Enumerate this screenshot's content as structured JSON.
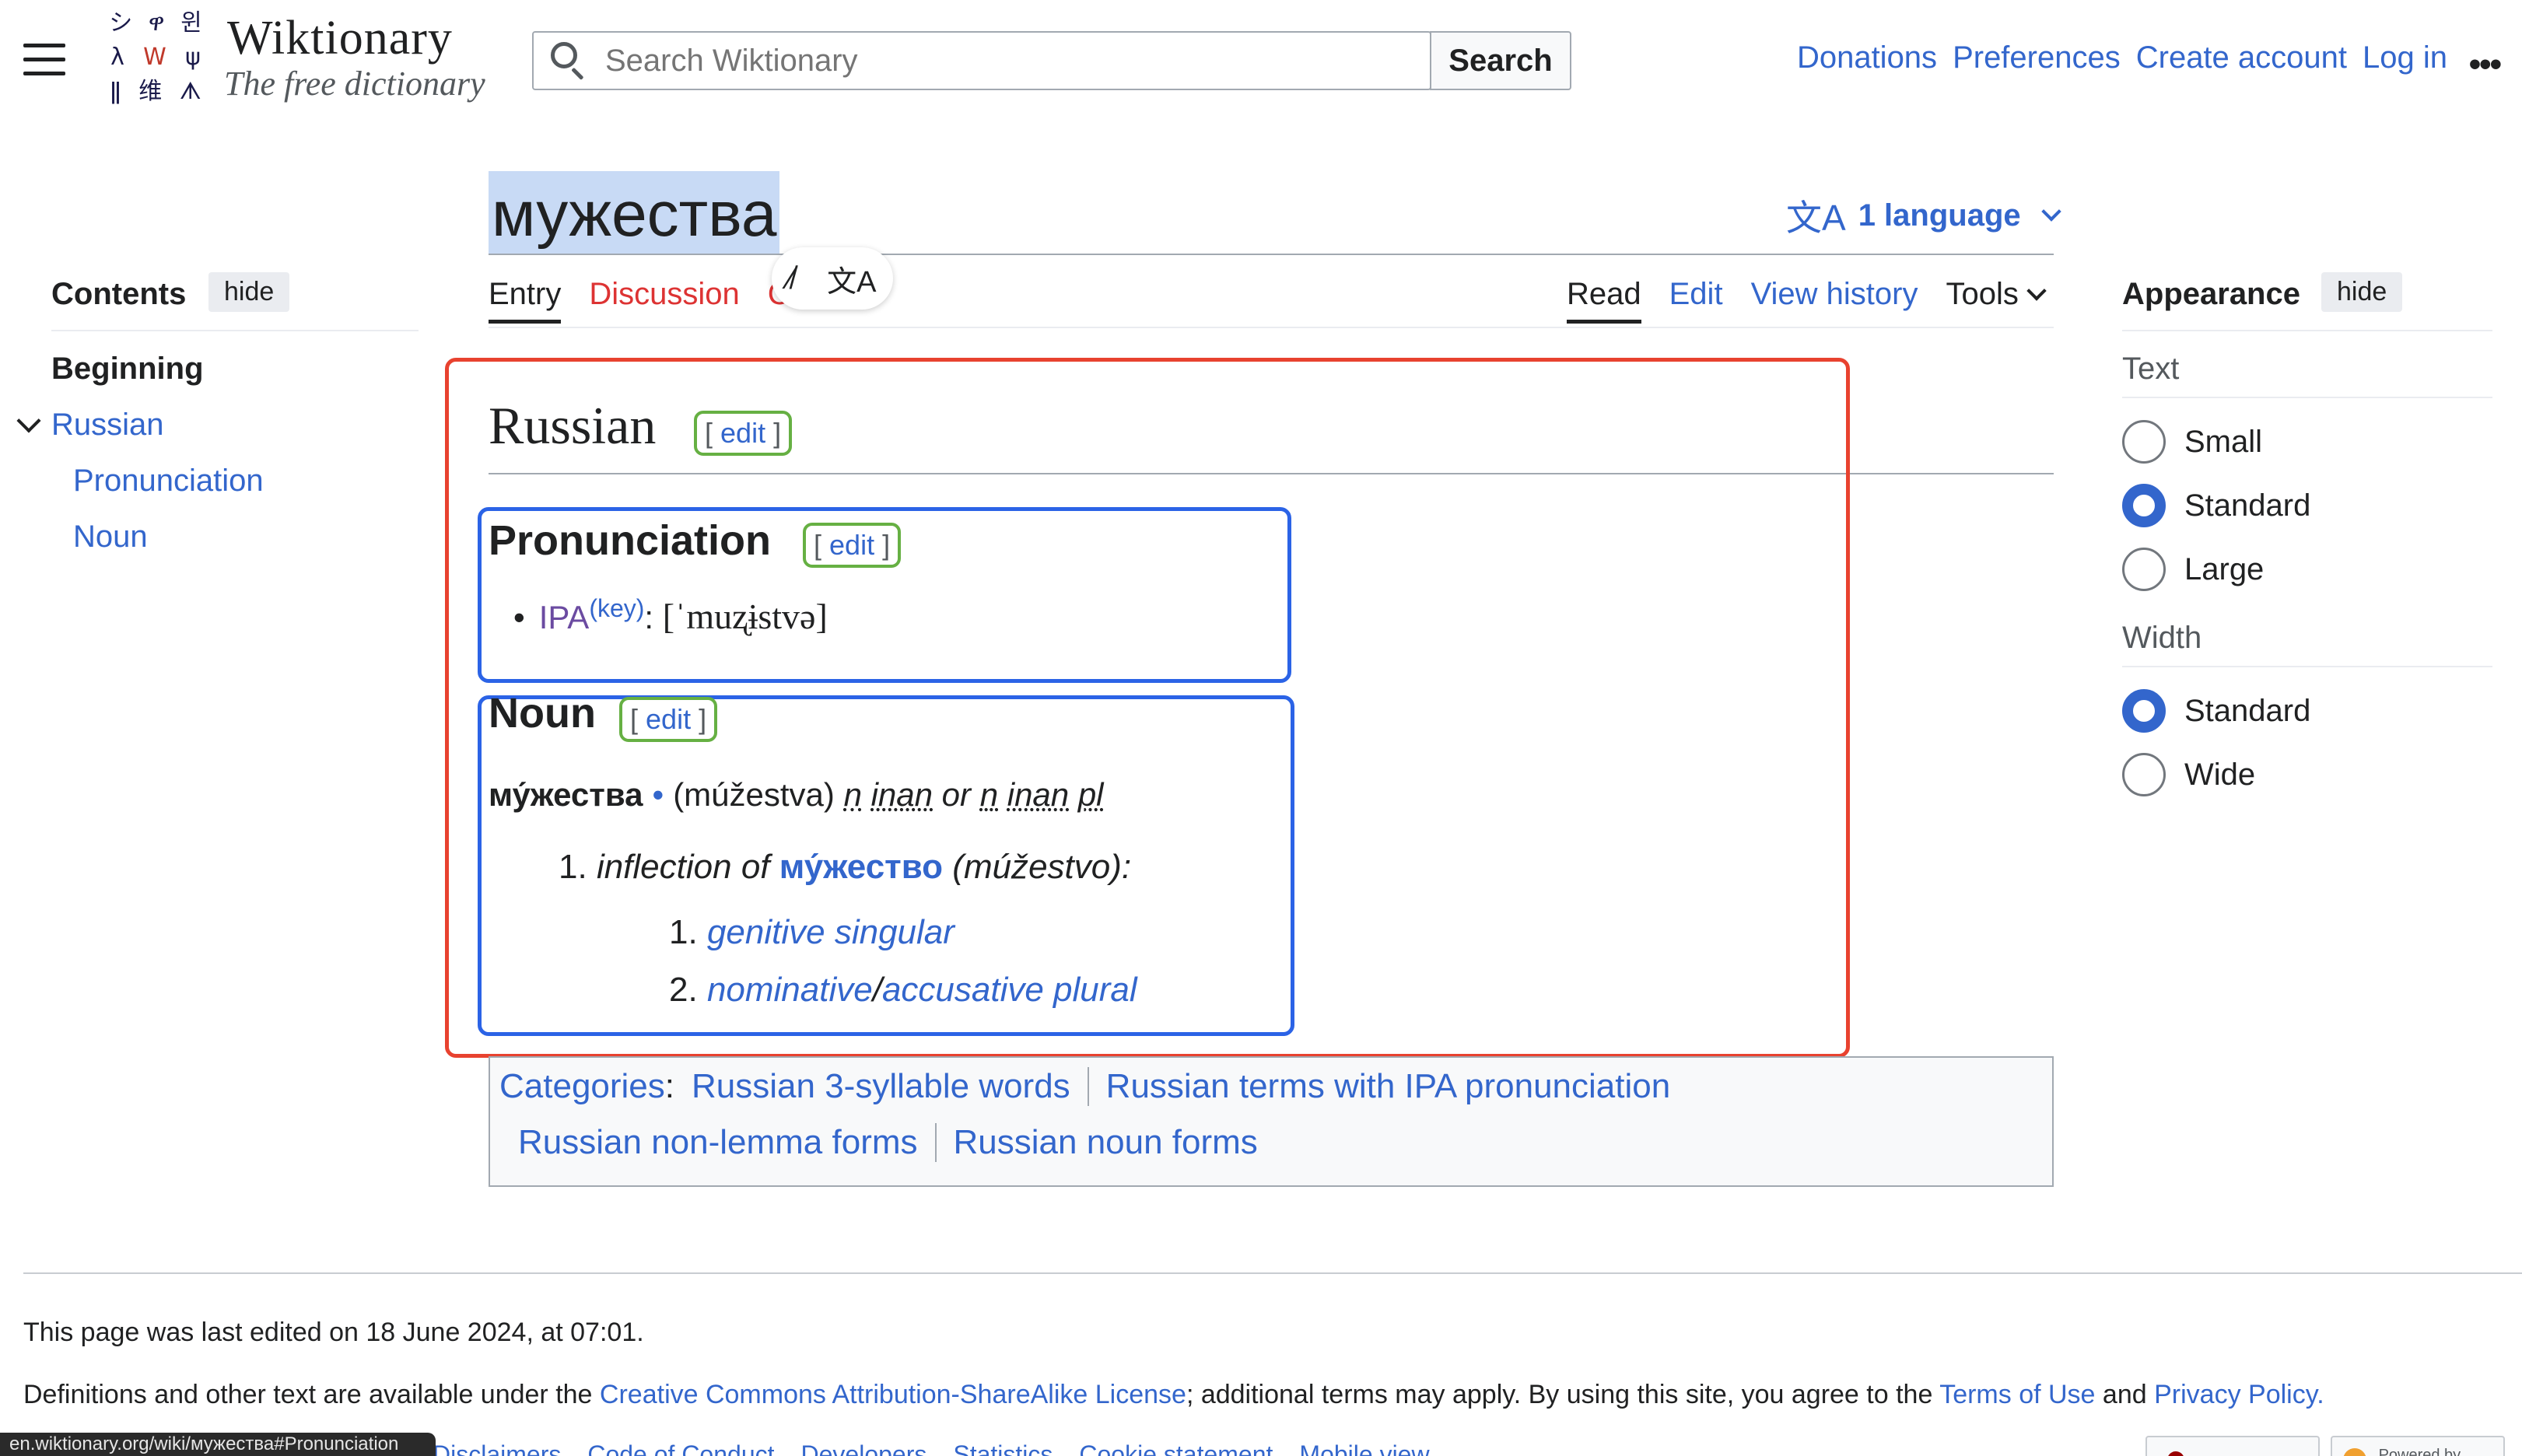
{
  "header": {
    "logo_glyphs": [
      "シ",
      "ዋ",
      "윈",
      "λ",
      "W",
      "ψ",
      "ǁ",
      "维",
      "ᗑ"
    ],
    "site_title": "Wiktionary",
    "site_subtitle": "The free dictionary",
    "search_placeholder": "Search Wiktionary",
    "search_button": "Search",
    "links": [
      "Donations",
      "Preferences",
      "Create account",
      "Log in"
    ],
    "more": "•••"
  },
  "page": {
    "title": "мужества",
    "language_button": "1 language",
    "tabs_left": [
      "Entry",
      "Discussion",
      "C"
    ],
    "tabs_right": [
      "Read",
      "Edit",
      "View history",
      "Tools"
    ]
  },
  "toc": {
    "title": "Contents",
    "hide": "hide",
    "items": [
      "Beginning",
      "Russian",
      "Pronunciation",
      "Noun"
    ]
  },
  "appearance": {
    "title": "Appearance",
    "hide": "hide",
    "text_label": "Text",
    "text_options": [
      "Small",
      "Standard",
      "Large"
    ],
    "text_selected": "Standard",
    "width_label": "Width",
    "width_options": [
      "Standard",
      "Wide"
    ],
    "width_selected": "Standard"
  },
  "content": {
    "language_heading": "Russian",
    "edit_open": "[",
    "edit_label": "edit",
    "edit_close": "]",
    "pronunciation_heading": "Pronunciation",
    "ipa_label": "IPA",
    "ipa_key": "(key)",
    "ipa_colon": ":",
    "ipa_value": "[ˈmuʐɨstvə]",
    "noun_heading": "Noun",
    "headword": "му́жества",
    "dot": "•",
    "translit": "(múžestva)",
    "gender1": "n",
    "anim1": "inan",
    "or": "or",
    "gender2": "n",
    "anim2": "inan",
    "number": "pl",
    "def_number": "1.",
    "def_prefix": "inflection of",
    "def_lemma": "му́жество",
    "def_lemma_translit": "(múžestvo)",
    "def_colon": ":",
    "sub_defs": [
      {
        "num": "1.",
        "parts": [
          "genitive singular"
        ]
      },
      {
        "num": "2.",
        "parts": [
          "nominative",
          "/",
          "accusative plural"
        ]
      }
    ]
  },
  "categories": {
    "label": "Categories",
    "colon": ":",
    "items": [
      "Russian 3-syllable words",
      "Russian terms with IPA pronunciation",
      "Russian non-lemma forms",
      "Russian noun forms"
    ]
  },
  "footer": {
    "last_edited": "This page was last edited on 18 June 2024, at 07:01.",
    "license_prefix": "Definitions and other text are available under the",
    "license_link": "Creative Commons Attribution-ShareAlike License",
    "license_mid": "; additional terms may apply. By using this site, you agree to the",
    "terms_link": "Terms of Use",
    "and": "and",
    "privacy_link": "Privacy Policy.",
    "status_url": "en.wiktionary.org/wiki/мужества#Pronunciation",
    "links": [
      "Disclaimers",
      "Code of Conduct",
      "Developers",
      "Statistics",
      "Cookie statement",
      "Mobile view"
    ],
    "badge_powered": "Powered by"
  },
  "colors": {
    "link": "#3366cc",
    "red_highlight": "#e8422f",
    "blue_highlight": "#2b63e6",
    "green_highlight": "#66b043",
    "title_selection": "#c8daf5"
  }
}
